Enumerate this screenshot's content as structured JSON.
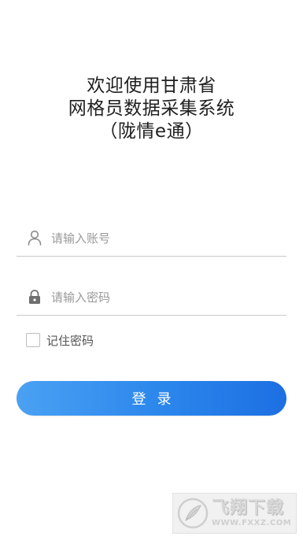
{
  "title": {
    "line1": "欢迎使用甘肃省",
    "line2": "网格员数据采集系统",
    "line3": "（陇情e通）"
  },
  "form": {
    "username_placeholder": "请输入账号",
    "username_value": "",
    "password_placeholder": "请输入密码",
    "password_value": "",
    "remember_label": "记住密码",
    "remember_checked": false,
    "login_label": "登录"
  },
  "watermark": {
    "main_text": "飞翔下载",
    "url_text": "WWW.FXXZ.COM"
  },
  "icons": {
    "username": "user-icon",
    "password": "lock-icon",
    "watermark_logo": "feather-logo-icon"
  },
  "colors": {
    "button_gradient_start": "#4aa1f3",
    "button_gradient_end": "#1d6fe2",
    "field_underline": "#c9c9c9",
    "placeholder": "#9a9a9a"
  }
}
